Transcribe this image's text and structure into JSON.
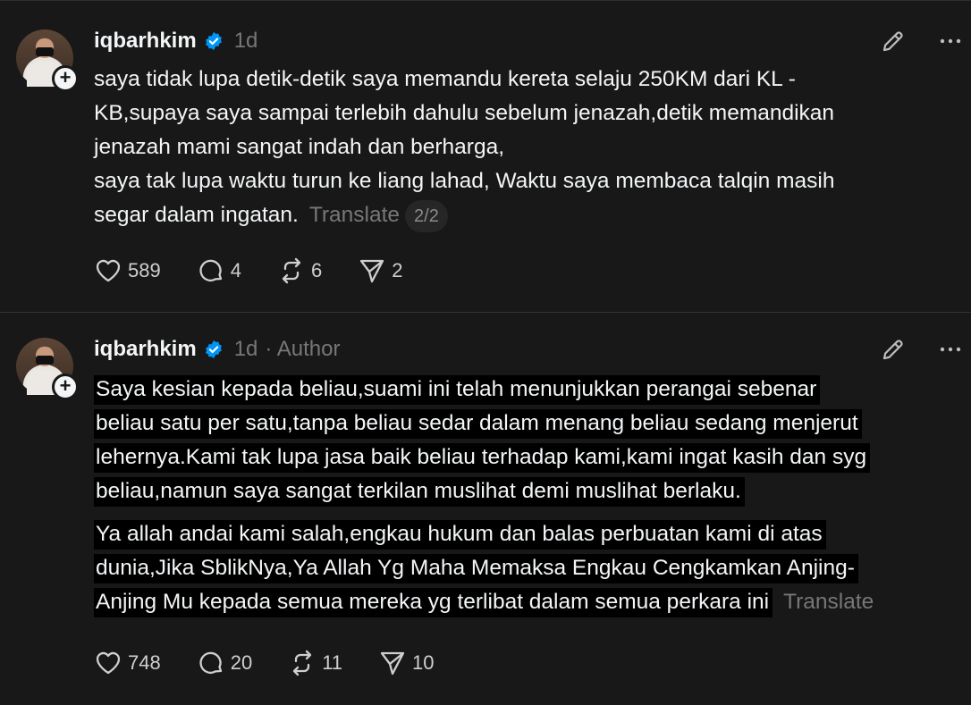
{
  "posts": [
    {
      "username": "iqbarhkim",
      "time": "1d",
      "author_tag": "",
      "lines": [
        "saya tidak lupa detik-detik saya memandu kereta selaju 250KM dari KL -",
        "KB,supaya saya sampai terlebih dahulu sebelum jenazah,detik memandikan",
        "jenazah mami sangat indah dan berharga,",
        "saya tak lupa waktu turun ke liang lahad, Waktu saya membaca talqin masih",
        "segar dalam ingatan."
      ],
      "translate_label": "Translate",
      "pager": "2/2",
      "stats": {
        "likes": "589",
        "replies": "4",
        "reposts": "6",
        "shares": "2"
      }
    },
    {
      "username": "iqbarhkim",
      "time": "1d",
      "author_tag": "· Author",
      "paragraph1": [
        "Saya kesian kepada beliau,suami ini telah menunjukkan perangai sebenar",
        "beliau satu per satu,tanpa beliau sedar dalam menang beliau sedang menjerut",
        "lehernya.Kami tak lupa jasa baik beliau terhadap kami,kami ingat kasih dan syg",
        "beliau,namun saya sangat terkilan muslihat demi muslihat berlaku."
      ],
      "paragraph2": [
        "Ya allah andai kami salah,engkau hukum dan balas perbuatan kami di atas",
        "dunia,Jika SblikNya,Ya Allah Yg Maha Memaksa Engkau Cengkamkan Anjing-",
        "Anjing Mu kepada semua mereka yg terlibat dalam semua perkara ini"
      ],
      "translate_label": "Translate",
      "stats": {
        "likes": "748",
        "replies": "20",
        "reposts": "11",
        "shares": "10"
      }
    }
  ],
  "icons": {
    "verified": "verified-badge-icon",
    "edit": "pencil-icon",
    "more": "more-dots-icon",
    "like": "heart-icon",
    "reply": "comment-icon",
    "repost": "repost-icon",
    "share": "send-icon",
    "follow": "plus-icon"
  },
  "colors": {
    "background": "#181818",
    "text": "#f3f5f7",
    "muted": "#777777",
    "verified": "#0095f6"
  }
}
